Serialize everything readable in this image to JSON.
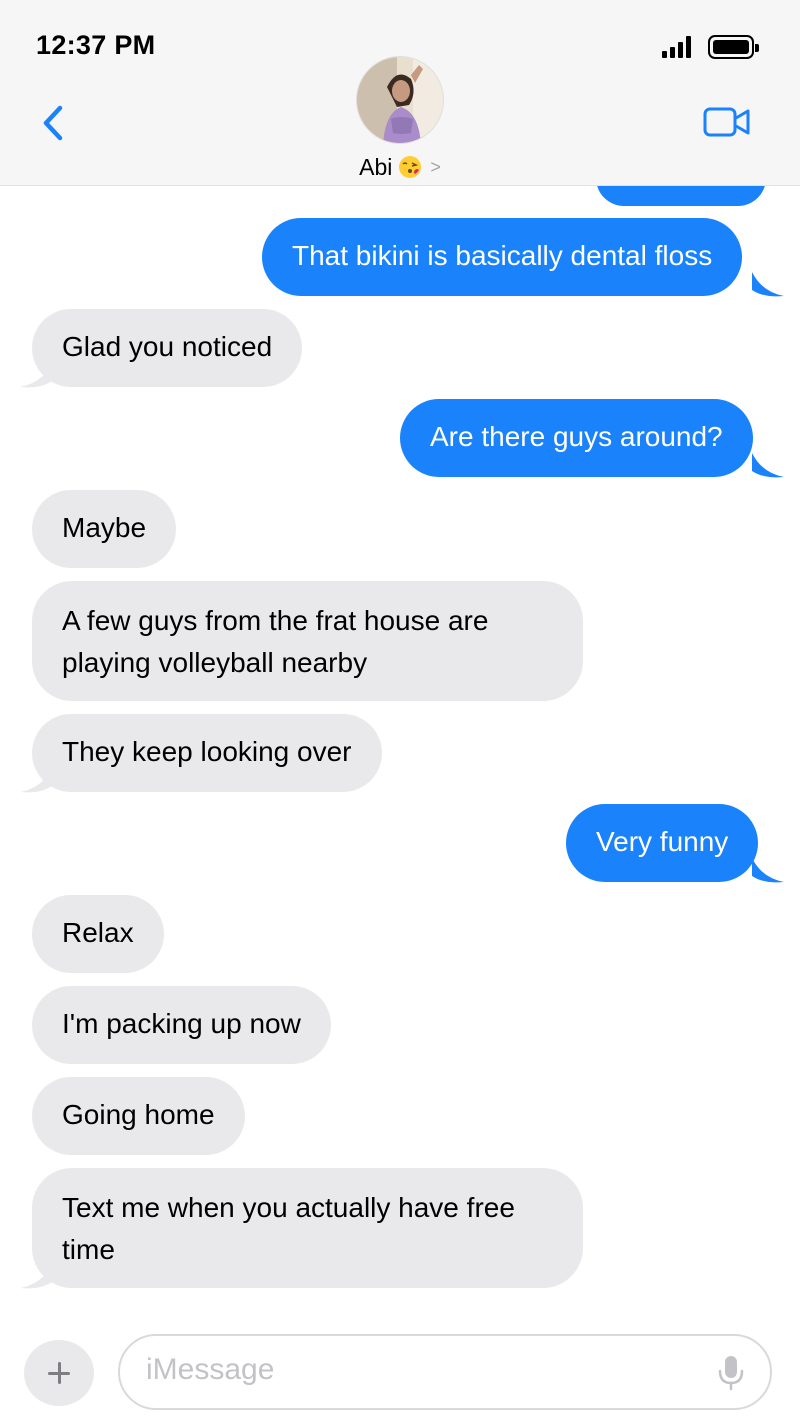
{
  "status_bar": {
    "time": "12:37 PM"
  },
  "header": {
    "contact_name": "Abi",
    "contact_emoji_icon": "face-blowing-kiss-icon",
    "accent_color": "#1a82fb"
  },
  "messages": [
    {
      "side": "out",
      "text": "That bikini is basically dental floss"
    },
    {
      "side": "in",
      "text": "Glad you noticed"
    },
    {
      "side": "out",
      "text": "Are there guys around?"
    },
    {
      "side": "in",
      "text": "Maybe"
    },
    {
      "side": "in",
      "text": "A few guys from the frat house are playing volleyball nearby"
    },
    {
      "side": "in",
      "text": "They keep looking over"
    },
    {
      "side": "out",
      "text": "Very funny"
    },
    {
      "side": "in",
      "text": "Relax"
    },
    {
      "side": "in",
      "text": "I'm packing up now"
    },
    {
      "side": "in",
      "text": "Going home"
    },
    {
      "side": "in",
      "text": "Text me when you actually have free time"
    }
  ],
  "composer": {
    "placeholder": "iMessage"
  },
  "colors": {
    "outgoing_bubble": "#1a82fb",
    "incoming_bubble": "#e9e9eb",
    "header_bg": "#f6f6f6"
  }
}
